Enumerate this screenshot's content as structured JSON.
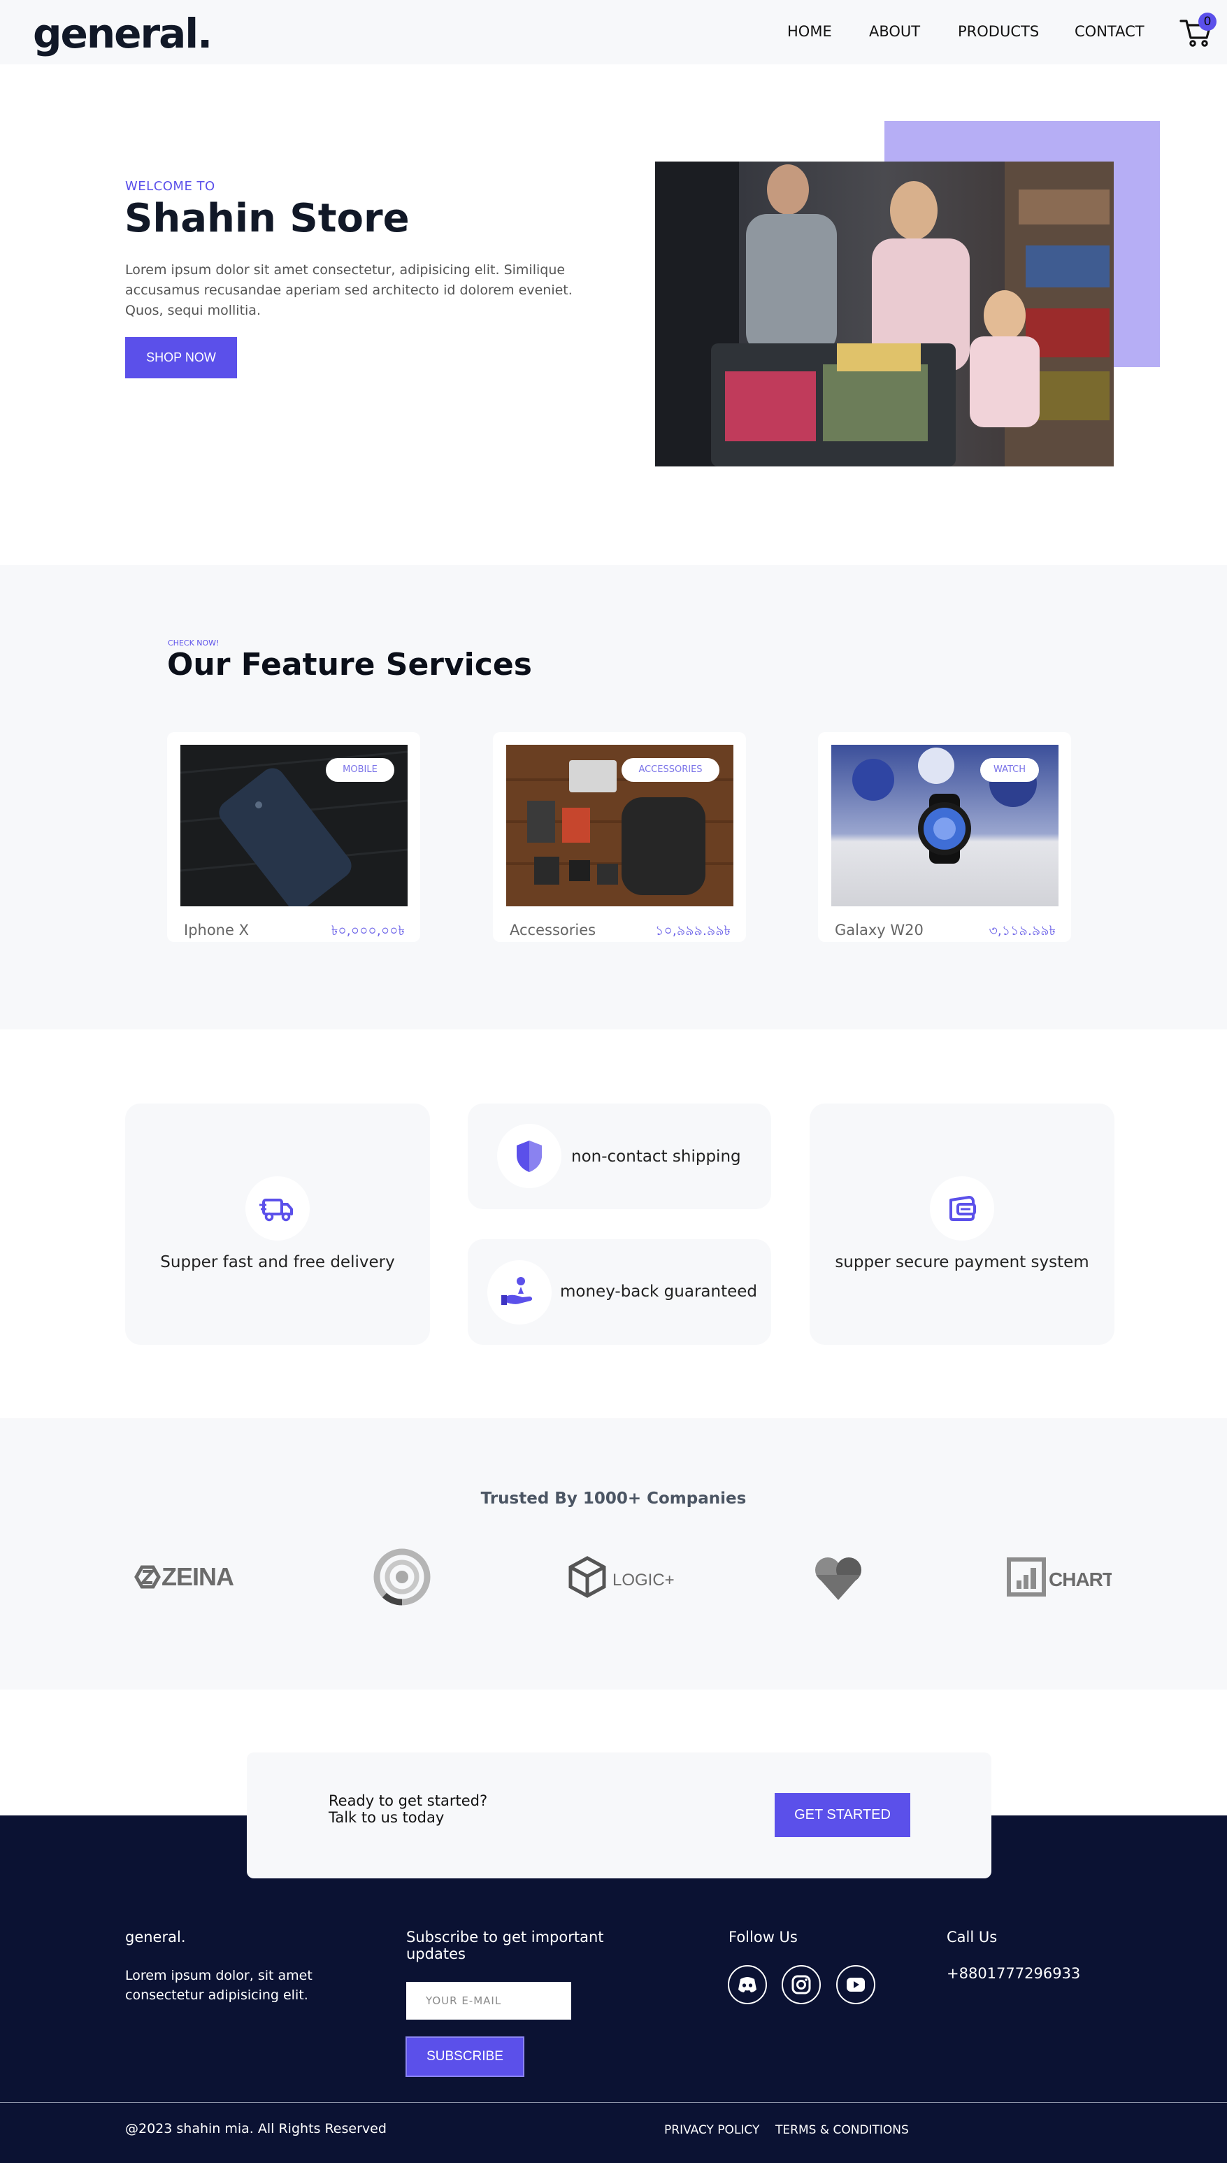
{
  "header": {
    "logo": "general.",
    "nav": [
      "HOME",
      "ABOUT",
      "PRODUCTS",
      "CONTACT"
    ],
    "cart_count": "0",
    "icons": [
      "cart-icon"
    ]
  },
  "hero": {
    "eyebrow": "WELCOME TO",
    "title": "Shahin Store",
    "description": "Lorem ipsum dolor sit amet consectetur, adipisicing elit. Similique accusamus recusandae aperiam sed architecto id dolorem eveniet. Quos, sequi mollitia.",
    "cta": "SHOP NOW"
  },
  "services": {
    "eyebrow": "CHECK NOW!",
    "title": "Our Feature Services",
    "cards": [
      {
        "badge": "MOBILE",
        "name": "Iphone X",
        "price": "৳০,০০০,০০৳"
      },
      {
        "badge": "ACCESSORIES",
        "name": "Accessories",
        "price": "১০,৯৯৯.৯৯৳"
      },
      {
        "badge": "WATCH",
        "name": "Galaxy W20",
        "price": "৩,১১৯.৯৯৳"
      }
    ]
  },
  "features": {
    "items": [
      {
        "label": "Supper fast and free delivery",
        "icon": "truck-icon"
      },
      {
        "label": "non-contact shipping",
        "icon": "shield-icon"
      },
      {
        "label": "money-back guaranteed",
        "icon": "money-hand-icon"
      },
      {
        "label": "supper secure payment system",
        "icon": "wallet-icon"
      }
    ]
  },
  "trusted": {
    "title": "Trusted By 1000+ Companies",
    "brands": [
      "ZEINA",
      "LOGIC+",
      "CHARTZ"
    ]
  },
  "cta": {
    "line1": "Ready to get started?",
    "line2": "Talk to us today",
    "button": "GET STARTED"
  },
  "footer": {
    "brand": "general.",
    "brand_desc_1": "Lorem ipsum dolor, sit amet",
    "brand_desc_2": "consectetur adipisicing elit.",
    "subscribe_title_1": "Subscribe to get important",
    "subscribe_title_2": "updates",
    "email_placeholder": "YOUR E-MAIL",
    "subscribe_button": "SUBSCRIBE",
    "follow_title": "Follow Us",
    "social_icons": [
      "discord-icon",
      "instagram-icon",
      "youtube-icon"
    ],
    "call_title": "Call Us",
    "phone": "+8801777296933",
    "copyright": "@2023 shahin mia. All Rights Reserved",
    "links": [
      "PRIVACY POLICY",
      "TERMS & CONDITIONS"
    ]
  },
  "colors": {
    "accent": "#5b50ea",
    "accent_light": "#b6aef5",
    "section_bg": "#f7f8fa",
    "footer_bg": "#0b1233"
  }
}
